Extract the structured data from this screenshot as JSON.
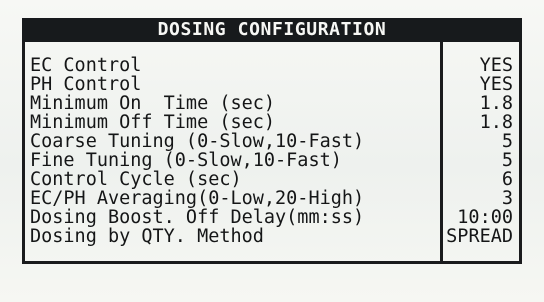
{
  "screen": {
    "title": "DOSING CONFIGURATION",
    "items": [
      {
        "label": "EC Control",
        "value": "YES"
      },
      {
        "label": "PH Control",
        "value": "YES"
      },
      {
        "label": "Minimum On  Time (sec)",
        "value": "1.8"
      },
      {
        "label": "Minimum Off Time (sec)",
        "value": "1.8"
      },
      {
        "label": "Coarse Tuning (0-Slow,10-Fast)",
        "value": "5"
      },
      {
        "label": "Fine Tuning (0-Slow,10-Fast)",
        "value": "5"
      },
      {
        "label": "Control Cycle (sec)",
        "value": "6"
      },
      {
        "label": "EC/PH Averaging(0-Low,20-High)",
        "value": "3"
      },
      {
        "label": "Dosing Boost. Off Delay(mm:ss)",
        "value": "10:00"
      },
      {
        "label": "Dosing by QTY. Method",
        "value": "SPREAD"
      }
    ]
  }
}
